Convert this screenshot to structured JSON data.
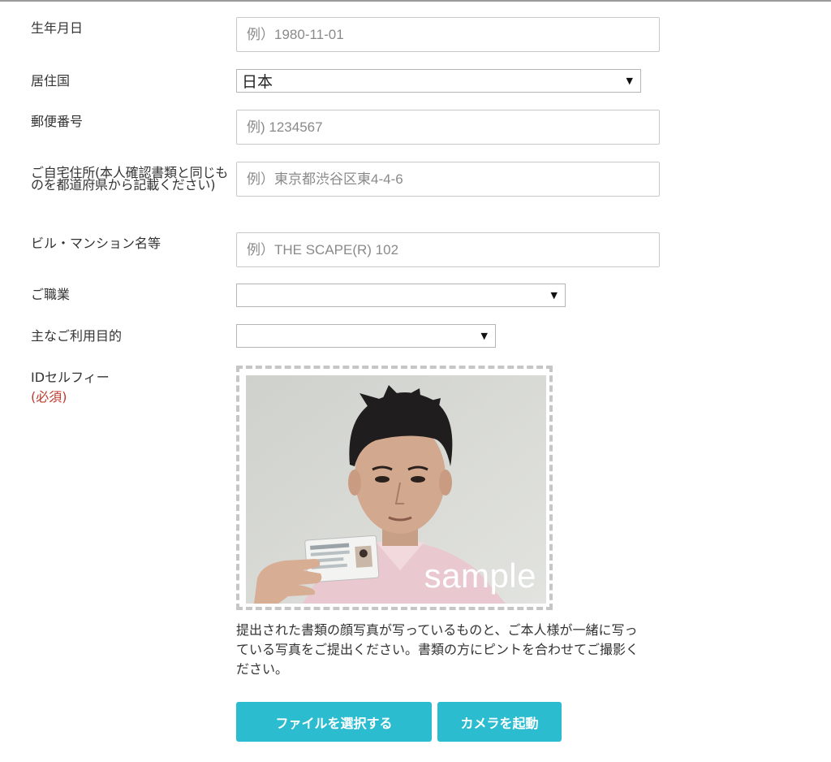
{
  "form": {
    "birthdate": {
      "label": "生年月日",
      "placeholder": "例）1980-11-01"
    },
    "country": {
      "label": "居住国",
      "selected": "日本"
    },
    "postal_code": {
      "label": "郵便番号",
      "placeholder": "例) 1234567"
    },
    "address": {
      "label": "ご自宅住所(本人確認書類と同じものを都道府県から記載ください)",
      "placeholder": "例）東京都渋谷区東4-4-6"
    },
    "building": {
      "label": "ビル・マンション名等",
      "placeholder": "例）THE SCAPE(R) 102"
    },
    "occupation": {
      "label": "ご職業",
      "selected": ""
    },
    "purpose": {
      "label": "主なご利用目的",
      "selected": ""
    },
    "id_selfie": {
      "label": "IDセルフィー",
      "required": "(必須)",
      "sample_watermark": "sample",
      "note": "提出された書類の顔写真が写っているものと、ご本人様が一緒に写っている写真をご提出ください。書類の方にピントを合わせてご撮影ください。"
    }
  },
  "buttons": {
    "select_file": "ファイルを選択する",
    "start_camera": "カメラを起動"
  },
  "icons": {
    "dropdown": "dropdown-arrow-icon"
  },
  "colors": {
    "button_bg": "#2bbcd0",
    "required_text": "#c0392b",
    "frame_border": "#c6c6c6"
  }
}
